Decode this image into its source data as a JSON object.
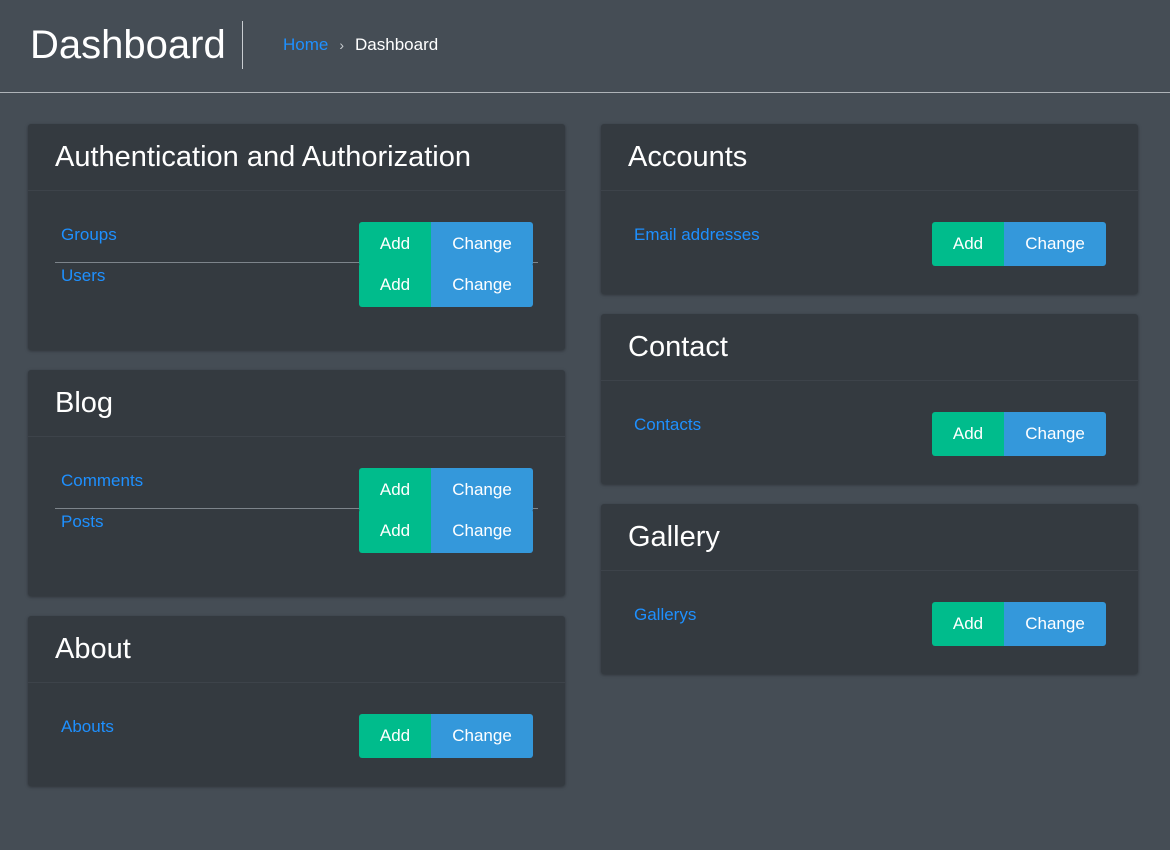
{
  "header": {
    "title": "Dashboard",
    "breadcrumb": {
      "home": "Home",
      "separator": "›",
      "current": "Dashboard"
    }
  },
  "buttons": {
    "add": "Add",
    "change": "Change"
  },
  "colors": {
    "background": "#454d55",
    "card": "#343a40",
    "link": "#1e90ff",
    "add_button": "#00bc8c",
    "change_button": "#3498db"
  },
  "left_column": [
    {
      "title": "Authentication and Authorization",
      "models": [
        "Groups",
        "Users"
      ]
    },
    {
      "title": "Blog",
      "models": [
        "Comments",
        "Posts"
      ]
    },
    {
      "title": "About",
      "models": [
        "Abouts"
      ]
    }
  ],
  "right_column": [
    {
      "title": "Accounts",
      "models": [
        "Email addresses"
      ]
    },
    {
      "title": "Contact",
      "models": [
        "Contacts"
      ]
    },
    {
      "title": "Gallery",
      "models": [
        "Gallerys"
      ]
    }
  ]
}
